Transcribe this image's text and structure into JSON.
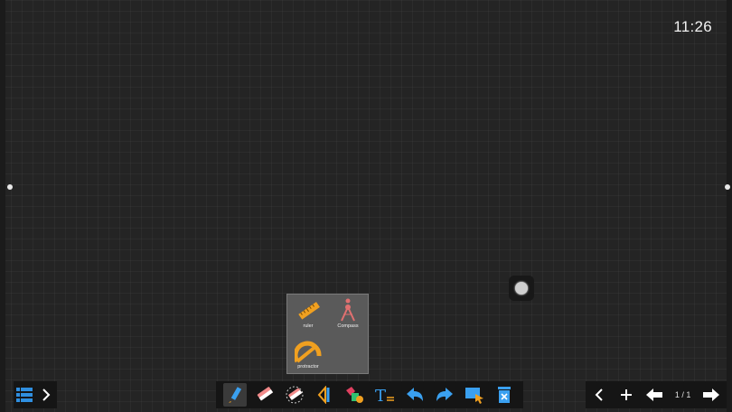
{
  "clock": {
    "time": "11:26"
  },
  "tools_popup": {
    "items": [
      {
        "label": "ruler",
        "icon": "ruler-icon"
      },
      {
        "label": "Compass",
        "icon": "compass-icon"
      },
      {
        "label": "protractor",
        "icon": "protractor-icon"
      }
    ]
  },
  "toolbar": {
    "menu_icon": "menu-list-icon",
    "expand_icon": "chevron-right-icon",
    "tools": [
      "pen-icon",
      "eraser-icon",
      "area-eraser-icon",
      "tools-icon",
      "shapes-icon",
      "text-icon",
      "undo-icon",
      "redo-icon",
      "select-icon",
      "clear-icon"
    ],
    "active_tool": "pen-icon"
  },
  "pager": {
    "prev_icon": "chevron-left-icon",
    "add_icon": "plus-icon",
    "page_prev_icon": "arrow-left-icon",
    "indicator": "1 / 1",
    "page_next_icon": "arrow-right-icon"
  },
  "colors": {
    "canvas": "#242424",
    "toolbar": "#151515",
    "accent_blue": "#2f8fe0",
    "accent_orange": "#f0a020"
  }
}
